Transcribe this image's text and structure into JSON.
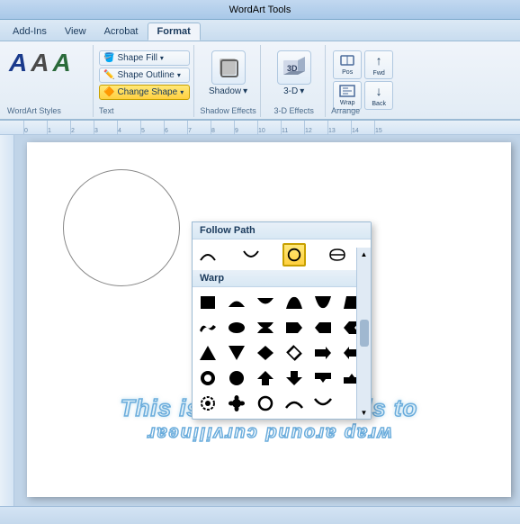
{
  "titleBar": {
    "text": "WordArt Tools"
  },
  "tabs": [
    {
      "label": "Add-Ins",
      "active": false
    },
    {
      "label": "View",
      "active": false
    },
    {
      "label": "Acrobat",
      "active": false
    },
    {
      "label": "Format",
      "active": true
    }
  ],
  "ribbon": {
    "groups": {
      "wordartStyles": {
        "label": "WordArt Styles",
        "letters": [
          "A",
          "A",
          "A"
        ]
      },
      "shapeFill": {
        "label": "Shape Fill",
        "dropdownLabel": "▾"
      },
      "shapeOutline": {
        "label": "Shape Outline",
        "dropdownLabel": "▾"
      },
      "changeShape": {
        "label": "Change Shape",
        "dropdownLabel": "▾"
      },
      "shadowEffects": {
        "label": "Shadow Effects",
        "dropdownLabel": "▾"
      },
      "effects3d": {
        "label": "3-D Effects",
        "dropdownLabel": "▾"
      }
    }
  },
  "dropdown": {
    "title": "Change Shape",
    "sections": [
      {
        "header": "Follow Path",
        "shapes": [
          {
            "id": "fp1",
            "name": "arch-up"
          },
          {
            "id": "fp2",
            "name": "arch-down"
          },
          {
            "id": "fp3",
            "name": "circle",
            "selected": true
          },
          {
            "id": "fp4",
            "name": "button"
          }
        ]
      },
      {
        "header": "Warp",
        "shapes": [
          {
            "id": "w1",
            "name": "square"
          },
          {
            "id": "w2",
            "name": "arch-up-fill"
          },
          {
            "id": "w3",
            "name": "arch-down-fill"
          },
          {
            "id": "w4",
            "name": "arch-up-curve"
          },
          {
            "id": "w5",
            "name": "arch-down-curve"
          },
          {
            "id": "w6",
            "name": "trapezoid"
          },
          {
            "id": "w7",
            "name": "wave1"
          },
          {
            "id": "w8",
            "name": "wave2"
          },
          {
            "id": "w9",
            "name": "wave3"
          },
          {
            "id": "w10",
            "name": "chevron-right"
          },
          {
            "id": "w11",
            "name": "chevron-left"
          },
          {
            "id": "w12",
            "name": "chevron-fill"
          },
          {
            "id": "w13",
            "name": "diamond"
          },
          {
            "id": "w14",
            "name": "diamond-fill"
          },
          {
            "id": "w15",
            "name": "cross"
          },
          {
            "id": "w16",
            "name": "cross2"
          },
          {
            "id": "w17",
            "name": "triangle"
          },
          {
            "id": "w18",
            "name": "triangle-down"
          },
          {
            "id": "w19",
            "name": "chevron-r2"
          },
          {
            "id": "w20",
            "name": "chevron-l2"
          },
          {
            "id": "w21",
            "name": "ring"
          },
          {
            "id": "w22",
            "name": "double-wave"
          },
          {
            "id": "w23",
            "name": "arch-fill"
          },
          {
            "id": "w24",
            "name": "pentagon"
          },
          {
            "id": "w25",
            "name": "star"
          },
          {
            "id": "w26",
            "name": "flower"
          },
          {
            "id": "w27",
            "name": "gear"
          },
          {
            "id": "w28",
            "name": "circle2"
          },
          {
            "id": "w29",
            "name": "arc"
          },
          {
            "id": "w30",
            "name": "arc2"
          }
        ]
      }
    ]
  },
  "canvas": {
    "wordart": {
      "line1": "This is text that needs to",
      "line2": "wrap around curvilinear"
    }
  },
  "statusBar": {
    "text": ""
  }
}
